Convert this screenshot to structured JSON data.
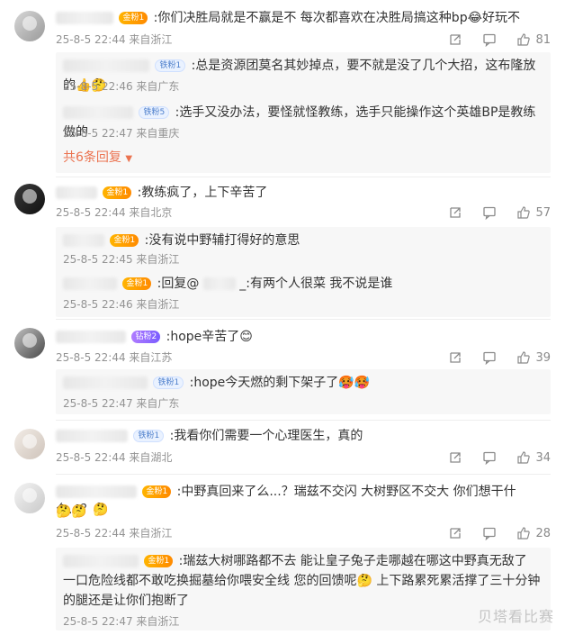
{
  "comments": [
    {
      "text": ":你们决胜局就是不赢是不 每次都喜欢在决胜局搞这种bp😂好玩不",
      "badge": "金粉1",
      "meta": "25-8-5 22:44 来自浙江",
      "likes": "81",
      "replies": [
        {
          "badge": "铁粉1",
          "text": ":总是资源团莫名其妙掉点，要不就是没了几个大招，这布隆放的👍🤔",
          "meta": "25-8-5 22:46 来自广东"
        },
        {
          "badge": "铁粉5",
          "text": ":选手又没办法，要怪就怪教练，选手只能操作这个英雄BP是教练做的",
          "meta": "25-8-5 22:47 来自重庆"
        }
      ],
      "more_replies": "共6条回复"
    },
    {
      "text": ":教练疯了，上下辛苦了",
      "badge": "金粉1",
      "meta": "25-8-5 22:44 来自北京",
      "likes": "57",
      "replies": [
        {
          "badge": "金粉1",
          "text": ":没有说中野辅打得好的意思",
          "meta": "25-8-5 22:45 来自浙江"
        },
        {
          "badge": "金粉1",
          "text": ":回复@",
          "text_tail": "_:有两个人很菜 我不说是谁",
          "meta": "25-8-5 22:46 来自浙江"
        }
      ]
    },
    {
      "text": ":hope辛苦了😊",
      "badge": "钻粉2",
      "meta": "25-8-5 22:44 来自江苏",
      "likes": "39",
      "replies": [
        {
          "badge": "铁粉1",
          "text": ":hope今天燃的剩下架子了🥵🥵",
          "meta": "25-8-5 22:47 来自广东"
        }
      ]
    },
    {
      "text": ":我看你们需要一个心理医生，真的",
      "badge": "铁粉1",
      "meta": "25-8-5 22:44 来自湖北",
      "likes": "34",
      "replies": []
    },
    {
      "text": ":中野真回来了么...？瑞兹不交闪 大树野区不交大 你们想干什么...？🤔",
      "text2": "🤔🤔",
      "badge": "金粉1",
      "meta": "25-8-5 22:44 来自浙江",
      "likes": "28",
      "replies": [
        {
          "badge": "金粉1",
          "text": ":瑞兹大树哪路都不去 能让皇子兔子走哪越在哪这中野真无敌了 一口危险线都不敢吃换掘墓给你喂安全线 您的回馈呢🤔 上下路累死累活撑了三十分钟的腿还是让你们抱断了",
          "meta": "25-8-5 22:47 来自浙江"
        }
      ]
    }
  ],
  "watermark": "贝塔看比赛",
  "colors": {
    "accent": "#eb7350",
    "meta": "#939393",
    "reply_bg": "#f7f7f7"
  },
  "icons": [
    "share-icon",
    "comment-icon",
    "like-icon",
    "caret-down-icon"
  ]
}
